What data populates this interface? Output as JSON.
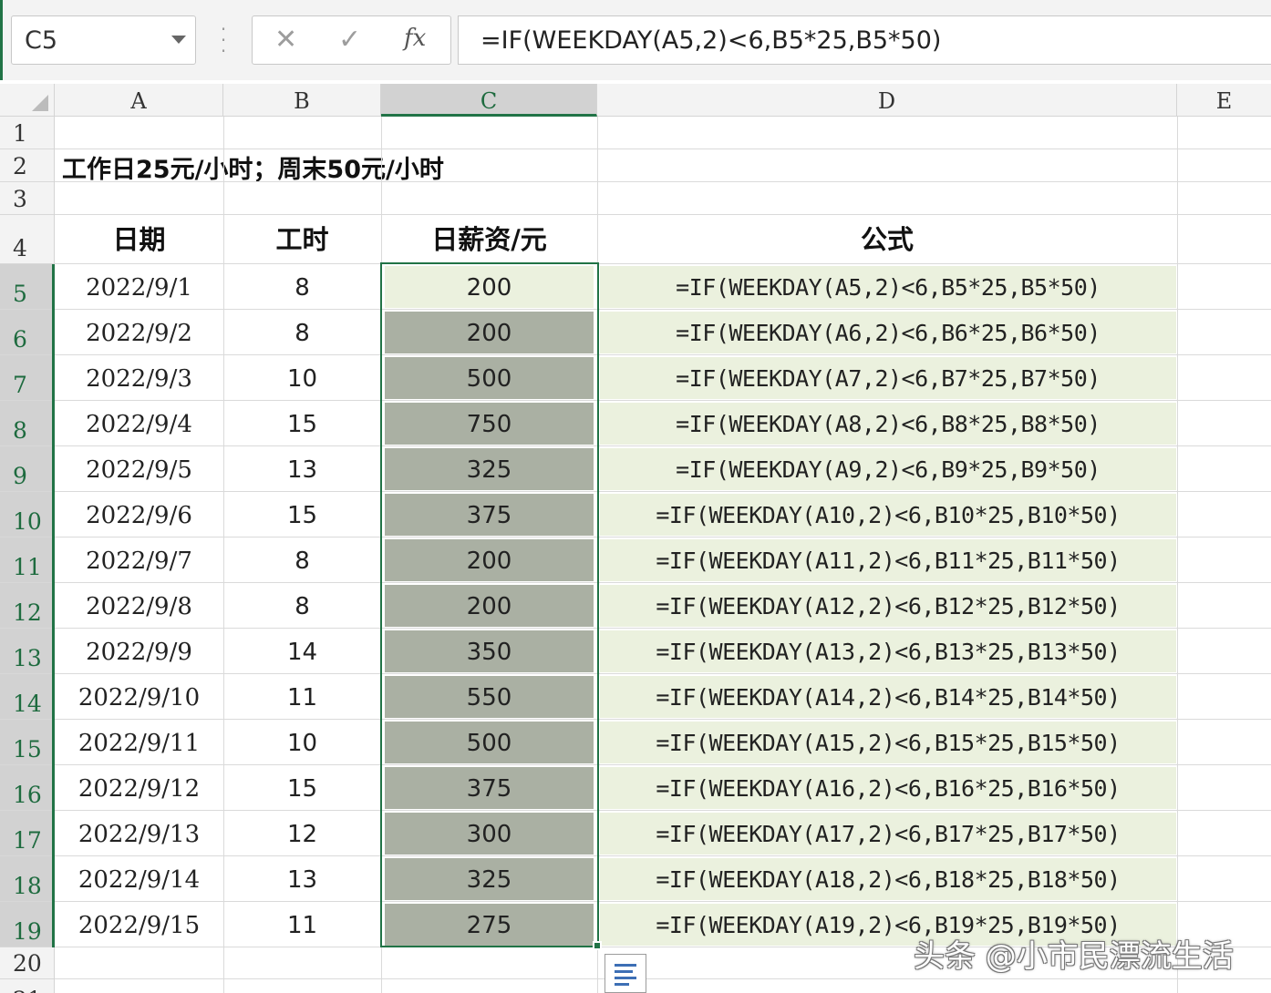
{
  "formula_bar": {
    "name_box": "C5",
    "cancel_icon": "✕",
    "confirm_icon": "✓",
    "fx_icon": "fx",
    "formula": "=IF(WEEKDAY(A5,2)<6,B5*25,B5*50)"
  },
  "columns": [
    "A",
    "B",
    "C",
    "D",
    "E"
  ],
  "rows": [
    "1",
    "2",
    "3",
    "4",
    "5",
    "6",
    "7",
    "8",
    "9",
    "10",
    "11",
    "12",
    "13",
    "14",
    "15",
    "16",
    "17",
    "18",
    "19",
    "20",
    "21"
  ],
  "title_cell": "工作日25元/小时；周末50元/小时",
  "headers": {
    "date": "日期",
    "hours": "工时",
    "wage": "日薪资/元",
    "formula": "公式"
  },
  "records": [
    {
      "date": "2022/9/1",
      "hours": "8",
      "wage": "200",
      "formula": "=IF(WEEKDAY(A5,2)<6,B5*25,B5*50)"
    },
    {
      "date": "2022/9/2",
      "hours": "8",
      "wage": "200",
      "formula": "=IF(WEEKDAY(A6,2)<6,B6*25,B6*50)"
    },
    {
      "date": "2022/9/3",
      "hours": "10",
      "wage": "500",
      "formula": "=IF(WEEKDAY(A7,2)<6,B7*25,B7*50)"
    },
    {
      "date": "2022/9/4",
      "hours": "15",
      "wage": "750",
      "formula": "=IF(WEEKDAY(A8,2)<6,B8*25,B8*50)"
    },
    {
      "date": "2022/9/5",
      "hours": "13",
      "wage": "325",
      "formula": "=IF(WEEKDAY(A9,2)<6,B9*25,B9*50)"
    },
    {
      "date": "2022/9/6",
      "hours": "15",
      "wage": "375",
      "formula": "=IF(WEEKDAY(A10,2)<6,B10*25,B10*50)"
    },
    {
      "date": "2022/9/7",
      "hours": "8",
      "wage": "200",
      "formula": "=IF(WEEKDAY(A11,2)<6,B11*25,B11*50)"
    },
    {
      "date": "2022/9/8",
      "hours": "8",
      "wage": "200",
      "formula": "=IF(WEEKDAY(A12,2)<6,B12*25,B12*50)"
    },
    {
      "date": "2022/9/9",
      "hours": "14",
      "wage": "350",
      "formula": "=IF(WEEKDAY(A13,2)<6,B13*25,B13*50)"
    },
    {
      "date": "2022/9/10",
      "hours": "11",
      "wage": "550",
      "formula": "=IF(WEEKDAY(A14,2)<6,B14*25,B14*50)"
    },
    {
      "date": "2022/9/11",
      "hours": "10",
      "wage": "500",
      "formula": "=IF(WEEKDAY(A15,2)<6,B15*25,B15*50)"
    },
    {
      "date": "2022/9/12",
      "hours": "15",
      "wage": "375",
      "formula": "=IF(WEEKDAY(A16,2)<6,B16*25,B16*50)"
    },
    {
      "date": "2022/9/13",
      "hours": "12",
      "wage": "300",
      "formula": "=IF(WEEKDAY(A17,2)<6,B17*25,B17*50)"
    },
    {
      "date": "2022/9/14",
      "hours": "13",
      "wage": "325",
      "formula": "=IF(WEEKDAY(A18,2)<6,B18*25,B18*50)"
    },
    {
      "date": "2022/9/15",
      "hours": "11",
      "wage": "275",
      "formula": "=IF(WEEKDAY(A19,2)<6,B19*25,B19*50)"
    }
  ],
  "watermark": "头条 @小市民漂流生活",
  "colors": {
    "selection": "#217346",
    "formula_fill": "#ebf1de",
    "selected_range_fill": "#aab0a3"
  }
}
